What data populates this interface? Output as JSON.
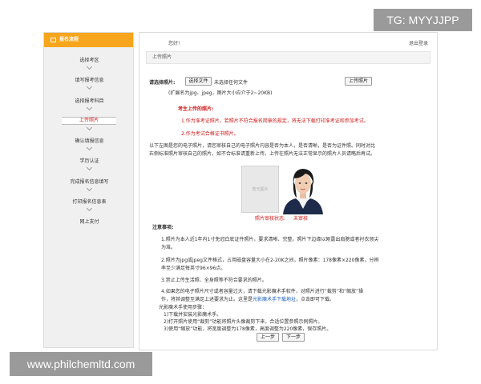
{
  "watermarks": {
    "top": "TG: MYYJJPP",
    "bottom": "www.philchemltd.com"
  },
  "sidebar": {
    "title": "报名流程",
    "items": [
      {
        "label": "选择考区"
      },
      {
        "label": "填写报考信息"
      },
      {
        "label": "选择报考科目"
      },
      {
        "label": "上传照片",
        "active": true
      },
      {
        "label": "确认填报信息"
      },
      {
        "label": "学历认证"
      },
      {
        "label": "完成报名信息填写"
      },
      {
        "label": "打印报名信息表"
      },
      {
        "label": "网上支付"
      }
    ]
  },
  "header": {
    "greeting": "您好!",
    "logout": "退出登录"
  },
  "section_title": "上传照片",
  "upload": {
    "label": "请选择照片:",
    "choose_button": "选择文件",
    "no_file": "未选择任何文件",
    "upload_button": "上传照片",
    "hint": "(扩展名为jpg、jpeg，图片大小应介于2~20KB)"
  },
  "requirements": {
    "title": "考生上传的照片:",
    "items": [
      "1.作为准考证照片，若照片不符合报名简章的规定，将无法下载打印准考证和参加考试。",
      "2.作为考试合格证书照片。"
    ]
  },
  "intro": [
    "以下左图是您的电子照片，请您审核自己的电子照片内容是否为本人，是否清晰，是否为证件照。同时对比",
    "右侧标准照片审核自己的照片，如不合标准请重新上传。上传在照片无法正常显示的照片人员请略后再试。"
  ],
  "photo": {
    "placeholder": "暂无图片",
    "status_label": "照片审核状态:",
    "status_value": "未审核"
  },
  "notes": {
    "title": "注意事项:",
    "items": [
      [
        "1.照片为本人近1年内1寸免冠白底证件照片，要求清晰、完整。照片下边缘以刚露出肩膀或者衬衣领尖",
        "为准。"
      ],
      [
        "2.照片为jpg或jpeg文件格式，占用磁盘容量大小在2-20K之间，照片像素：178像素×220像素，分辨",
        "率至少满足每英寸96×96点。"
      ],
      [
        "3.禁止上传生活照、全身照等不符合要求的照片。"
      ],
      [
        "4.如果您的电子照片尺寸或者容量过大，请下载光影魔术手软件，对照片进行“裁剪”和“缩放”操",
        "作，将其调整至满足上述要求为止。这里是",
        "光影魔术手下载地址",
        "，点击即可下载。"
      ],
      [
        "光影魔术手使用步骤：",
        "1)下载并安装光影魔术手。",
        "2)打开照片使用“裁剪”功能将照片头像裁剪下来，合适位置参照示例照片。",
        "3)使用“缩放”功能，将宽度调整为178像素，高度调整为220像素，保存照片。"
      ]
    ]
  },
  "nav": {
    "prev": "上一步",
    "next": "下一步"
  },
  "colors": {
    "accent": "#f6a51c",
    "warning": "#d01818",
    "link": "#1a5fc0"
  }
}
